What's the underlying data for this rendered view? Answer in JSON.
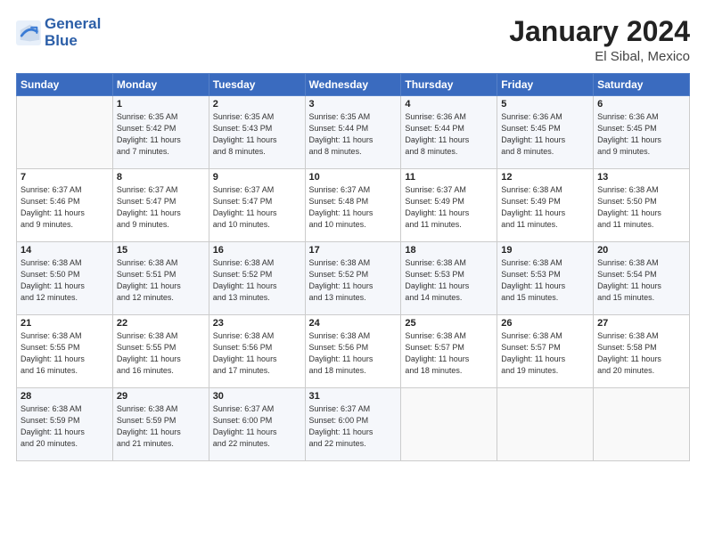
{
  "logo": {
    "line1": "General",
    "line2": "Blue"
  },
  "title": "January 2024",
  "location": "El Sibal, Mexico",
  "header_days": [
    "Sunday",
    "Monday",
    "Tuesday",
    "Wednesday",
    "Thursday",
    "Friday",
    "Saturday"
  ],
  "weeks": [
    [
      {
        "num": "",
        "info": ""
      },
      {
        "num": "1",
        "info": "Sunrise: 6:35 AM\nSunset: 5:42 PM\nDaylight: 11 hours\nand 7 minutes."
      },
      {
        "num": "2",
        "info": "Sunrise: 6:35 AM\nSunset: 5:43 PM\nDaylight: 11 hours\nand 8 minutes."
      },
      {
        "num": "3",
        "info": "Sunrise: 6:35 AM\nSunset: 5:44 PM\nDaylight: 11 hours\nand 8 minutes."
      },
      {
        "num": "4",
        "info": "Sunrise: 6:36 AM\nSunset: 5:44 PM\nDaylight: 11 hours\nand 8 minutes."
      },
      {
        "num": "5",
        "info": "Sunrise: 6:36 AM\nSunset: 5:45 PM\nDaylight: 11 hours\nand 8 minutes."
      },
      {
        "num": "6",
        "info": "Sunrise: 6:36 AM\nSunset: 5:45 PM\nDaylight: 11 hours\nand 9 minutes."
      }
    ],
    [
      {
        "num": "7",
        "info": "Sunrise: 6:37 AM\nSunset: 5:46 PM\nDaylight: 11 hours\nand 9 minutes."
      },
      {
        "num": "8",
        "info": "Sunrise: 6:37 AM\nSunset: 5:47 PM\nDaylight: 11 hours\nand 9 minutes."
      },
      {
        "num": "9",
        "info": "Sunrise: 6:37 AM\nSunset: 5:47 PM\nDaylight: 11 hours\nand 10 minutes."
      },
      {
        "num": "10",
        "info": "Sunrise: 6:37 AM\nSunset: 5:48 PM\nDaylight: 11 hours\nand 10 minutes."
      },
      {
        "num": "11",
        "info": "Sunrise: 6:37 AM\nSunset: 5:49 PM\nDaylight: 11 hours\nand 11 minutes."
      },
      {
        "num": "12",
        "info": "Sunrise: 6:38 AM\nSunset: 5:49 PM\nDaylight: 11 hours\nand 11 minutes."
      },
      {
        "num": "13",
        "info": "Sunrise: 6:38 AM\nSunset: 5:50 PM\nDaylight: 11 hours\nand 11 minutes."
      }
    ],
    [
      {
        "num": "14",
        "info": "Sunrise: 6:38 AM\nSunset: 5:50 PM\nDaylight: 11 hours\nand 12 minutes."
      },
      {
        "num": "15",
        "info": "Sunrise: 6:38 AM\nSunset: 5:51 PM\nDaylight: 11 hours\nand 12 minutes."
      },
      {
        "num": "16",
        "info": "Sunrise: 6:38 AM\nSunset: 5:52 PM\nDaylight: 11 hours\nand 13 minutes."
      },
      {
        "num": "17",
        "info": "Sunrise: 6:38 AM\nSunset: 5:52 PM\nDaylight: 11 hours\nand 13 minutes."
      },
      {
        "num": "18",
        "info": "Sunrise: 6:38 AM\nSunset: 5:53 PM\nDaylight: 11 hours\nand 14 minutes."
      },
      {
        "num": "19",
        "info": "Sunrise: 6:38 AM\nSunset: 5:53 PM\nDaylight: 11 hours\nand 15 minutes."
      },
      {
        "num": "20",
        "info": "Sunrise: 6:38 AM\nSunset: 5:54 PM\nDaylight: 11 hours\nand 15 minutes."
      }
    ],
    [
      {
        "num": "21",
        "info": "Sunrise: 6:38 AM\nSunset: 5:55 PM\nDaylight: 11 hours\nand 16 minutes."
      },
      {
        "num": "22",
        "info": "Sunrise: 6:38 AM\nSunset: 5:55 PM\nDaylight: 11 hours\nand 16 minutes."
      },
      {
        "num": "23",
        "info": "Sunrise: 6:38 AM\nSunset: 5:56 PM\nDaylight: 11 hours\nand 17 minutes."
      },
      {
        "num": "24",
        "info": "Sunrise: 6:38 AM\nSunset: 5:56 PM\nDaylight: 11 hours\nand 18 minutes."
      },
      {
        "num": "25",
        "info": "Sunrise: 6:38 AM\nSunset: 5:57 PM\nDaylight: 11 hours\nand 18 minutes."
      },
      {
        "num": "26",
        "info": "Sunrise: 6:38 AM\nSunset: 5:57 PM\nDaylight: 11 hours\nand 19 minutes."
      },
      {
        "num": "27",
        "info": "Sunrise: 6:38 AM\nSunset: 5:58 PM\nDaylight: 11 hours\nand 20 minutes."
      }
    ],
    [
      {
        "num": "28",
        "info": "Sunrise: 6:38 AM\nSunset: 5:59 PM\nDaylight: 11 hours\nand 20 minutes."
      },
      {
        "num": "29",
        "info": "Sunrise: 6:38 AM\nSunset: 5:59 PM\nDaylight: 11 hours\nand 21 minutes."
      },
      {
        "num": "30",
        "info": "Sunrise: 6:37 AM\nSunset: 6:00 PM\nDaylight: 11 hours\nand 22 minutes."
      },
      {
        "num": "31",
        "info": "Sunrise: 6:37 AM\nSunset: 6:00 PM\nDaylight: 11 hours\nand 22 minutes."
      },
      {
        "num": "",
        "info": ""
      },
      {
        "num": "",
        "info": ""
      },
      {
        "num": "",
        "info": ""
      }
    ]
  ]
}
